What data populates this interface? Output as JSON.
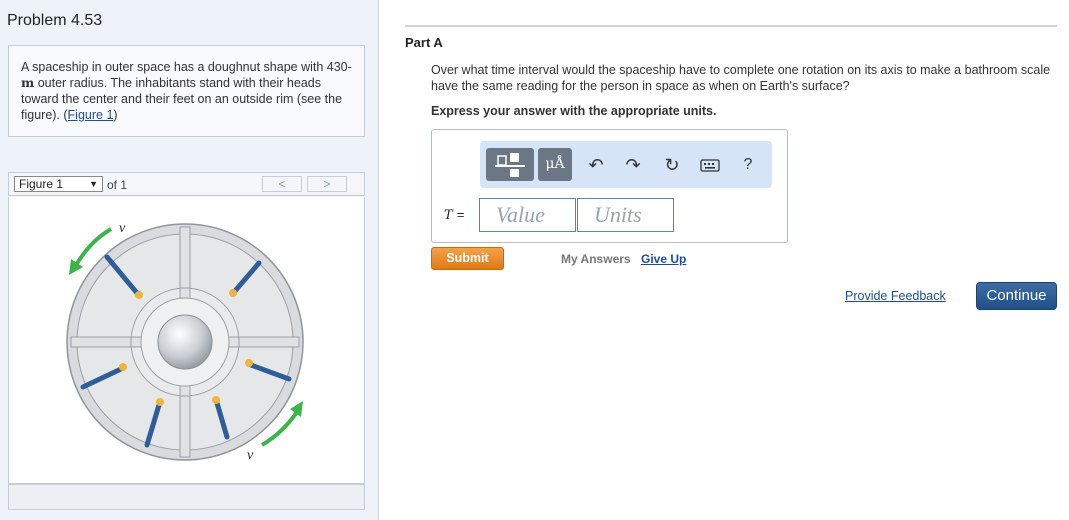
{
  "problem": {
    "title": "Problem 4.53",
    "text_before_unit": "A spaceship in outer space has a doughnut shape with 430-",
    "unit": "m",
    "text_after_unit": " outer radius. The inhabitants stand with their heads toward the center and their feet on an outside rim (see the figure). (",
    "figure_link": "Figure 1",
    "text_end": ")"
  },
  "figure_nav": {
    "selected": "Figure 1",
    "of_label": "of 1",
    "prev_label": "<",
    "next_label": ">",
    "figure_labels": {
      "v_top": "v",
      "v_bottom": "v"
    }
  },
  "part": {
    "label": "Part A",
    "question": "Over what time interval would the spaceship have to complete one rotation on its axis to make a bathroom scale have the same reading for the person in space as when on Earth's surface?",
    "instruction": "Express your answer with the appropriate units."
  },
  "answer": {
    "variable": "T",
    "equals": "=",
    "value_placeholder": "Value",
    "units_placeholder": "Units"
  },
  "toolbar": {
    "units_button_label": "μÅ",
    "help_label": "?",
    "icons": [
      "templates-icon",
      "units-icon",
      "undo-icon",
      "redo-icon",
      "reset-icon",
      "keyboard-icon",
      "help-icon"
    ]
  },
  "actions": {
    "submit_label": "Submit",
    "my_answers_label": "My Answers",
    "give_up_label": "Give Up",
    "feedback_label": "Provide Feedback",
    "continue_label": "Continue"
  },
  "colors": {
    "submit": "#e07b14",
    "continue": "#2a5a94",
    "link": "#1f4e96",
    "arrow": "#3bb54a"
  }
}
